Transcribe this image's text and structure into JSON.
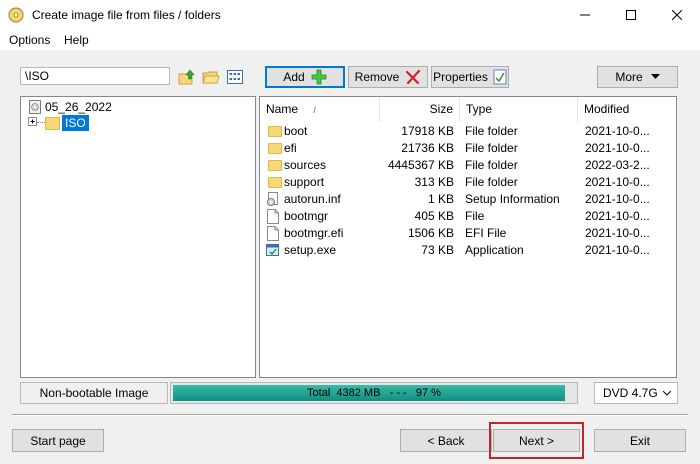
{
  "window": {
    "title": "Create image file from files / folders"
  },
  "menu": [
    "Options",
    "Help"
  ],
  "toolbar": {
    "path": "\\ISO",
    "add_label": "Add",
    "remove_label": "Remove",
    "properties_label": "Properties",
    "more_label": "More"
  },
  "tree": {
    "root": "05_26_2022",
    "child": "ISO"
  },
  "list": {
    "headers": {
      "name": "Name",
      "sort": "/",
      "size": "Size",
      "type": "Type",
      "modified": "Modified"
    },
    "rows": [
      {
        "name": "boot",
        "size": "17918 KB",
        "type": "File folder",
        "modified": "2021-10-0...",
        "icon": "folder-icon"
      },
      {
        "name": "efi",
        "size": "21736 KB",
        "type": "File folder",
        "modified": "2021-10-0...",
        "icon": "folder-icon"
      },
      {
        "name": "sources",
        "size": "4445367 KB",
        "type": "File folder",
        "modified": "2022-03-2...",
        "icon": "folder-icon"
      },
      {
        "name": "support",
        "size": "313 KB",
        "type": "File folder",
        "modified": "2021-10-0...",
        "icon": "folder-icon"
      },
      {
        "name": "autorun.inf",
        "size": "1 KB",
        "type": "Setup Information",
        "modified": "2021-10-0...",
        "icon": "gear-file-icon"
      },
      {
        "name": "bootmgr",
        "size": "405 KB",
        "type": "File",
        "modified": "2021-10-0...",
        "icon": "file-icon"
      },
      {
        "name": "bootmgr.efi",
        "size": "1506 KB",
        "type": "EFI File",
        "modified": "2021-10-0...",
        "icon": "file-icon"
      },
      {
        "name": "setup.exe",
        "size": "73 KB",
        "type": "Application",
        "modified": "2021-10-0...",
        "icon": "exe-icon"
      }
    ]
  },
  "status": {
    "media_type": "Non-bootable Image",
    "total_label": "Total",
    "total_size": "4382 MB",
    "dashes": "- - -",
    "percent": "97 %",
    "progress_fraction": 0.97,
    "disc": "DVD 4.7G"
  },
  "footer": {
    "start_label": "Start page",
    "back_label": "< Back",
    "next_label": "Next >",
    "exit_label": "Exit"
  },
  "colors": {
    "selection": "#0078d7",
    "progress": "#13a08c",
    "highlight_border": "#c0272d"
  }
}
